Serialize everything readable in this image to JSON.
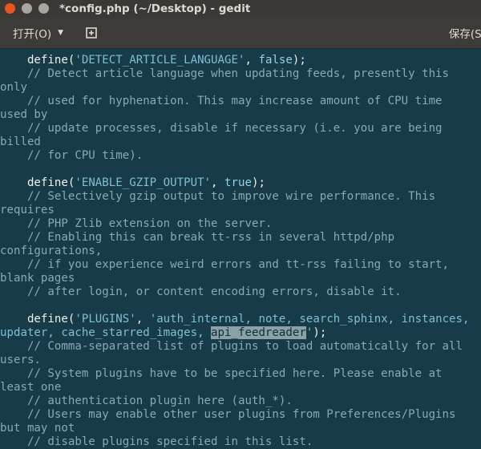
{
  "window": {
    "title": "*config.php (~/Desktop) - gedit"
  },
  "toolbar": {
    "open_label": "打开(O)",
    "save_label": "保存(S)"
  },
  "editor": {
    "lines": [
      {
        "parts": [
          {
            "t": "\tdefine(",
            "c": ""
          },
          {
            "t": "'DETECT_ARTICLE_LANGUAGE'",
            "c": "s"
          },
          {
            "t": ", ",
            "c": ""
          },
          {
            "t": "false",
            "c": "k"
          },
          {
            "t": ");",
            "c": ""
          }
        ]
      },
      {
        "parts": [
          {
            "t": "\t// Detect article language when updating feeds, presently this",
            "c": "c"
          }
        ]
      },
      {
        "parts": [
          {
            "t": "only",
            "c": "c"
          }
        ]
      },
      {
        "parts": [
          {
            "t": "\t// used for hyphenation. This may increase amount of CPU time",
            "c": "c"
          }
        ]
      },
      {
        "parts": [
          {
            "t": "used by",
            "c": "c"
          }
        ]
      },
      {
        "parts": [
          {
            "t": "\t// update processes, disable if necessary (i.e. you are being",
            "c": "c"
          }
        ]
      },
      {
        "parts": [
          {
            "t": "billed",
            "c": "c"
          }
        ]
      },
      {
        "parts": [
          {
            "t": "\t// for CPU time).",
            "c": "c"
          }
        ]
      },
      {
        "parts": [
          {
            "t": "",
            "c": ""
          }
        ]
      },
      {
        "parts": [
          {
            "t": "\tdefine(",
            "c": ""
          },
          {
            "t": "'ENABLE_GZIP_OUTPUT'",
            "c": "s"
          },
          {
            "t": ", ",
            "c": ""
          },
          {
            "t": "true",
            "c": "k"
          },
          {
            "t": ");",
            "c": ""
          }
        ]
      },
      {
        "parts": [
          {
            "t": "\t// Selectively gzip output to improve wire performance. This",
            "c": "c"
          }
        ]
      },
      {
        "parts": [
          {
            "t": "requires",
            "c": "c"
          }
        ]
      },
      {
        "parts": [
          {
            "t": "\t// PHP Zlib extension on the server.",
            "c": "c"
          }
        ]
      },
      {
        "parts": [
          {
            "t": "\t// Enabling this can break tt-rss in several httpd/php",
            "c": "c"
          }
        ]
      },
      {
        "parts": [
          {
            "t": "configurations,",
            "c": "c"
          }
        ]
      },
      {
        "parts": [
          {
            "t": "\t// if you experience weird errors and tt-rss failing to start,",
            "c": "c"
          }
        ]
      },
      {
        "parts": [
          {
            "t": "blank pages",
            "c": "c"
          }
        ]
      },
      {
        "parts": [
          {
            "t": "\t// after login, or content encoding errors, disable it.",
            "c": "c"
          }
        ]
      },
      {
        "parts": [
          {
            "t": "",
            "c": ""
          }
        ]
      },
      {
        "parts": [
          {
            "t": "\tdefine(",
            "c": ""
          },
          {
            "t": "'PLUGINS'",
            "c": "s"
          },
          {
            "t": ", ",
            "c": ""
          },
          {
            "t": "'auth_internal, note, search_sphinx, instances,",
            "c": "s"
          }
        ]
      },
      {
        "parts": [
          {
            "t": "updater, cache_starred_images, ",
            "c": "s"
          },
          {
            "t": "api_feedreader",
            "c": "sel"
          },
          {
            "t": "'",
            "c": "s"
          },
          {
            "t": ");",
            "c": ""
          }
        ]
      },
      {
        "parts": [
          {
            "t": "\t// Comma-separated list of plugins to load automatically for all",
            "c": "c"
          }
        ]
      },
      {
        "parts": [
          {
            "t": "users.",
            "c": "c"
          }
        ]
      },
      {
        "parts": [
          {
            "t": "\t// System plugins have to be specified here. Please enable at",
            "c": "c"
          }
        ]
      },
      {
        "parts": [
          {
            "t": "least one",
            "c": "c"
          }
        ]
      },
      {
        "parts": [
          {
            "t": "\t// authentication plugin here (auth_*).",
            "c": "c"
          }
        ]
      },
      {
        "parts": [
          {
            "t": "\t// Users may enable other user plugins from Preferences/Plugins",
            "c": "c"
          }
        ]
      },
      {
        "parts": [
          {
            "t": "but may not",
            "c": "c"
          }
        ]
      },
      {
        "parts": [
          {
            "t": "\t// disable plugins specified in this list.",
            "c": "c"
          }
        ]
      }
    ]
  }
}
